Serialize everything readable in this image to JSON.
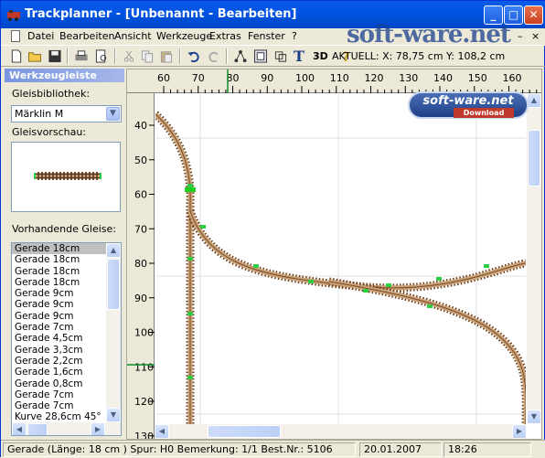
{
  "window": {
    "title": "Trackplanner - [Unbenannt - Bearbeiten]",
    "minimize": "_",
    "maximize": "□",
    "close": "✕"
  },
  "menu": {
    "items": [
      "Datei",
      "Bearbeiten",
      "Ansicht",
      "Werkzeuge",
      "Extras",
      "Fenster",
      "?"
    ],
    "mdi_min": "–",
    "mdi_close": "×"
  },
  "toolbar": {
    "icons": [
      "new-icon",
      "open-icon",
      "save-icon",
      "print-icon",
      "print-preview-icon",
      "cut-icon",
      "copy-icon",
      "paste-icon",
      "undo-icon",
      "redo-icon",
      "track-tree-icon",
      "select-icon",
      "layer-icon",
      "text-icon",
      "3d-icon",
      "help-icon"
    ],
    "text_tool": "T",
    "three_d": "3D",
    "coords": "AKTUELL: X: 78,75 cm Y: 108,2 cm"
  },
  "watermark": {
    "logo": "soft-ware.net",
    "badge_title": "soft-ware.net",
    "badge_sub": "Download"
  },
  "left_panel": {
    "header": "Werkzeugleiste",
    "library_label": "Gleisbibliothek:",
    "library_value": "Märklin M",
    "preview_label": "Gleisvorschau:",
    "tracks_label": "Vorhandende Gleise:",
    "tracks": [
      "Gerade 18cm",
      "Gerade 18cm",
      "Gerade 18cm",
      "Gerade 18cm",
      "Gerade 9cm",
      "Gerade 9cm",
      "Gerade 9cm",
      "Gerade 7cm",
      "Gerade 4,5cm",
      "Gerade 3,3cm",
      "Gerade 2,2cm",
      "Gerade 1,6cm",
      "Gerade 0,8cm",
      "Gerade 7cm",
      "Gerade 7cm",
      "Kurve 28,6cm 45°"
    ],
    "selected_index": 0
  },
  "rulers": {
    "x_ticks": [
      "60",
      "70",
      "80",
      "90",
      "100",
      "110",
      "120",
      "130",
      "140",
      "150",
      "160"
    ],
    "y_ticks": [
      "40",
      "50",
      "60",
      "70",
      "80",
      "90",
      "100",
      "110",
      "120",
      "130"
    ]
  },
  "status": {
    "info": "Gerade (Länge: 18 cm ) Spur: H0 Bemerkung: 1/1  Best.Nr.: 5106",
    "date": "20.01.2007",
    "time": "18:26"
  }
}
